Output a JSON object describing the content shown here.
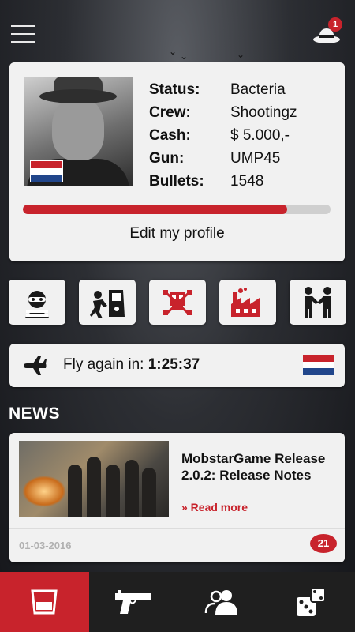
{
  "header": {
    "menu_icon": "hamburger-icon",
    "profile_icon": "fedora-hat-icon",
    "notification_count": "1"
  },
  "profile": {
    "flag_icon": "netherlands-flag-icon",
    "stats": [
      {
        "label": "Status:",
        "value": "Bacteria"
      },
      {
        "label": "Crew:",
        "value": "Shootingz"
      },
      {
        "label": "Cash:",
        "value": "$ 5.000,-"
      },
      {
        "label": "Gun:",
        "value": "UMP45"
      },
      {
        "label": "Bullets:",
        "value": "1548"
      }
    ],
    "progress_fraction": 0.86,
    "edit_label": "Edit my profile"
  },
  "actions": [
    {
      "icon": "robber-icon"
    },
    {
      "icon": "car-theft-icon"
    },
    {
      "icon": "skull-crossbones-icon"
    },
    {
      "icon": "factory-icon"
    },
    {
      "icon": "handshake-icon"
    }
  ],
  "travel": {
    "icon": "airplane-icon",
    "label": "Fly again in: ",
    "time": "1:25:37",
    "flag_icon": "netherlands-flag-icon"
  },
  "news": {
    "heading": "NEWS",
    "item": {
      "headline": "MobstarGame Release 2.0.2: Release Notes",
      "read_more": "» Read more",
      "date": "01-03-2016",
      "comments": "21"
    }
  },
  "bottom_nav": [
    {
      "icon": "whiskey-glass-icon",
      "active": true
    },
    {
      "icon": "pistol-icon",
      "active": false
    },
    {
      "icon": "people-icon",
      "active": false
    },
    {
      "icon": "dice-icon",
      "active": false
    }
  ],
  "colors": {
    "accent": "#c8232c",
    "card": "#f1f1f1",
    "nav": "#1f1f1f"
  }
}
